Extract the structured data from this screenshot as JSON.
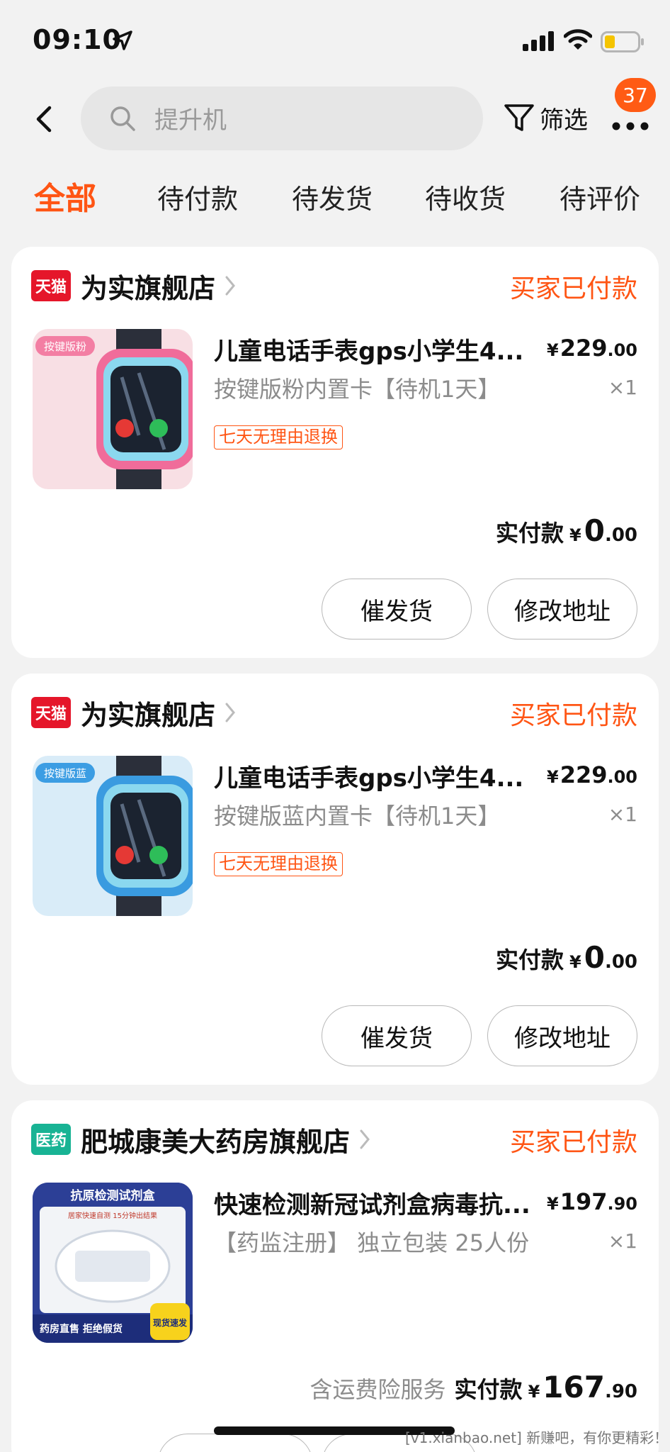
{
  "status_bar": {
    "time": "09:10"
  },
  "search": {
    "placeholder": "提升机",
    "filter_label": "筛选",
    "badge_count": "37"
  },
  "tabs": [
    {
      "label": "全部",
      "active": true
    },
    {
      "label": "待付款"
    },
    {
      "label": "待发货"
    },
    {
      "label": "待收货"
    },
    {
      "label": "待评价"
    }
  ],
  "orders": [
    {
      "store_logo": "天猫",
      "store_name": "为实旗舰店",
      "status": "买家已付款",
      "product_title": "儿童电话手表gps小学生4...",
      "price_currency": "¥",
      "price_int": "229",
      "price_dec": ".00",
      "sku": "按键版粉内置卡【待机1天】",
      "qty": "×1",
      "return_tag": "七天无理由退换",
      "thumb_label": "按键版粉",
      "paid_note": "",
      "paid_label": "实付款",
      "paid_currency": "¥",
      "paid_int": "0",
      "paid_dec": ".00",
      "btn_left": "催发货",
      "btn_right": "修改地址"
    },
    {
      "store_logo": "天猫",
      "store_name": "为实旗舰店",
      "status": "买家已付款",
      "product_title": "儿童电话手表gps小学生4...",
      "price_currency": "¥",
      "price_int": "229",
      "price_dec": ".00",
      "sku": "按键版蓝内置卡【待机1天】",
      "qty": "×1",
      "return_tag": "七天无理由退换",
      "thumb_label": "按键版蓝",
      "paid_note": "",
      "paid_label": "实付款",
      "paid_currency": "¥",
      "paid_int": "0",
      "paid_dec": ".00",
      "btn_left": "催发货",
      "btn_right": "修改地址"
    },
    {
      "store_logo": "医药",
      "store_name": "肥城康美大药房旗舰店",
      "status": "买家已付款",
      "product_title": "快速检测新冠试剂盒病毒抗...",
      "price_currency": "¥",
      "price_int": "197",
      "price_dec": ".90",
      "sku": "【药监注册】 独立包装 25人份",
      "qty": "×1",
      "thumb_title": "抗原检测试剂盒",
      "thumb_sub": "居家快速自测 15分钟出结果",
      "thumb_bottom": "药房直售 拒绝假货",
      "thumb_badge": "现货速发",
      "paid_note": "含运费险服务",
      "paid_label": "实付款",
      "paid_currency": "¥",
      "paid_int": "167",
      "paid_dec": ".90"
    }
  ],
  "watermark": "[v1.xianbao.net] 新赚吧，有你更精彩！",
  "colors": {
    "accent": "#ff5514",
    "tmall_red": "#e5162a",
    "pharmacy_green": "#18b394"
  }
}
